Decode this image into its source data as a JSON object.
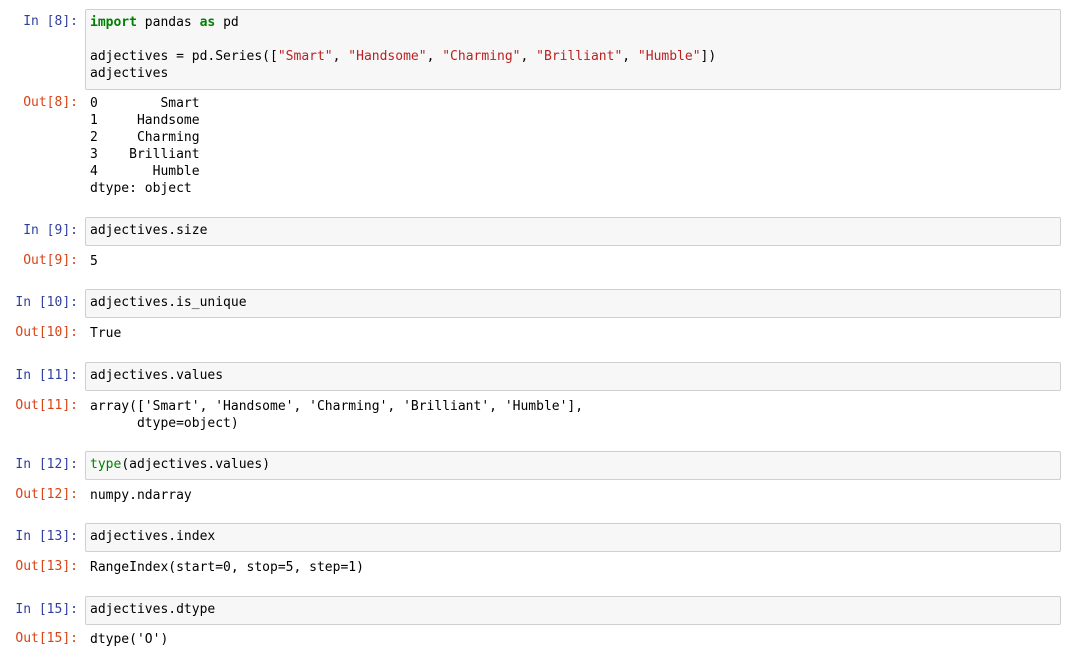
{
  "cells": [
    {
      "in_prompt": "In [8]:",
      "out_prompt": "Out[8]:",
      "code_lines": [
        [
          [
            "kw",
            "import"
          ],
          [
            "pln",
            " pandas "
          ],
          [
            "kw",
            "as"
          ],
          [
            "pln",
            " pd"
          ]
        ],
        [],
        [
          [
            "pln",
            "adjectives = pd.Series(["
          ],
          [
            "str",
            "\"Smart\""
          ],
          [
            "pln",
            ", "
          ],
          [
            "str",
            "\"Handsome\""
          ],
          [
            "pln",
            ", "
          ],
          [
            "str",
            "\"Charming\""
          ],
          [
            "pln",
            ", "
          ],
          [
            "str",
            "\"Brilliant\""
          ],
          [
            "pln",
            ", "
          ],
          [
            "str",
            "\"Humble\""
          ],
          [
            "pln",
            "])"
          ]
        ],
        [
          [
            "pln",
            "adjectives"
          ]
        ]
      ],
      "output_lines": [
        "0        Smart",
        "1     Handsome",
        "2     Charming",
        "3    Brilliant",
        "4       Humble",
        "dtype: object"
      ]
    },
    {
      "in_prompt": "In [9]:",
      "out_prompt": "Out[9]:",
      "code_lines": [
        [
          [
            "pln",
            "adjectives.size"
          ]
        ]
      ],
      "output_lines": [
        "5"
      ]
    },
    {
      "in_prompt": "In [10]:",
      "out_prompt": "Out[10]:",
      "code_lines": [
        [
          [
            "pln",
            "adjectives.is_unique"
          ]
        ]
      ],
      "output_lines": [
        "True"
      ]
    },
    {
      "in_prompt": "In [11]:",
      "out_prompt": "Out[11]:",
      "code_lines": [
        [
          [
            "pln",
            "adjectives.values"
          ]
        ]
      ],
      "output_lines": [
        "array(['Smart', 'Handsome', 'Charming', 'Brilliant', 'Humble'],",
        "      dtype=object)"
      ]
    },
    {
      "in_prompt": "In [12]:",
      "out_prompt": "Out[12]:",
      "code_lines": [
        [
          [
            "builtin",
            "type"
          ],
          [
            "pln",
            "(adjectives.values)"
          ]
        ]
      ],
      "output_lines": [
        "numpy.ndarray"
      ]
    },
    {
      "in_prompt": "In [13]:",
      "out_prompt": "Out[13]:",
      "code_lines": [
        [
          [
            "pln",
            "adjectives.index"
          ]
        ]
      ],
      "output_lines": [
        "RangeIndex(start=0, stop=5, step=1)"
      ]
    },
    {
      "in_prompt": "In [15]:",
      "out_prompt": "Out[15]:",
      "code_lines": [
        [
          [
            "pln",
            "adjectives.dtype"
          ]
        ]
      ],
      "output_lines": [
        "dtype('O')"
      ]
    }
  ]
}
